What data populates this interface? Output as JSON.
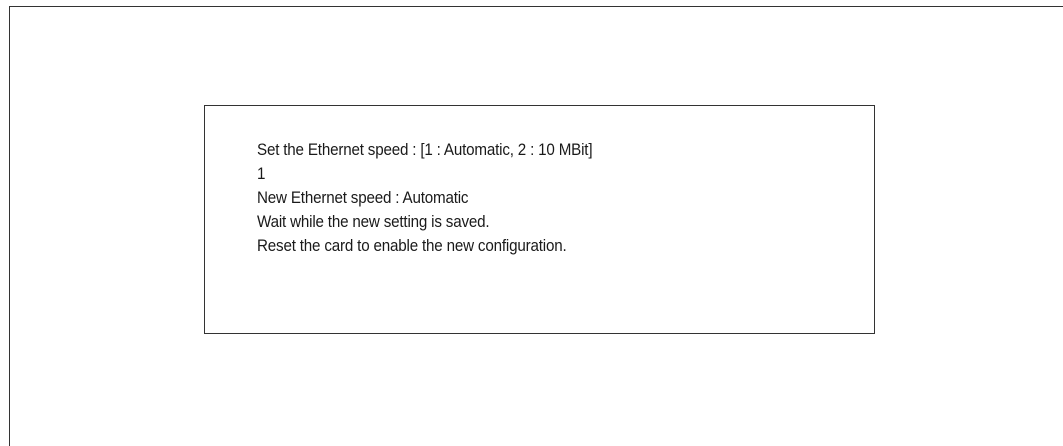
{
  "console": {
    "lines": [
      "Set the Ethernet speed : [1 : Automatic, 2 : 10 MBit]",
      "1",
      "New Ethernet speed : Automatic",
      "Wait while the new setting is saved.",
      "Reset the card to enable the new configuration."
    ]
  }
}
